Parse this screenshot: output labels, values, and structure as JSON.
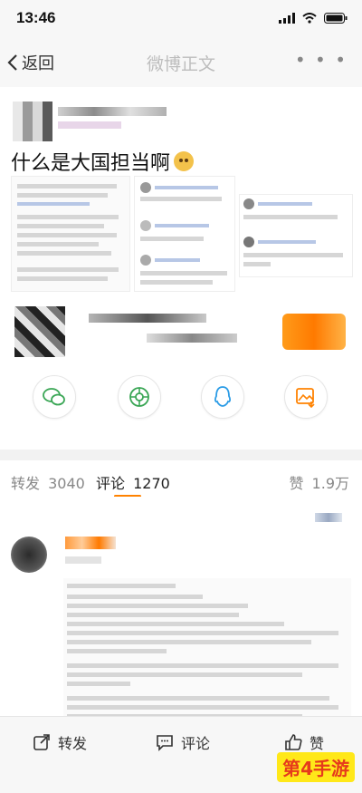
{
  "status_bar": {
    "time": "13:46"
  },
  "nav": {
    "back_label": "返回",
    "title": "微博正文",
    "more_label": "• • •"
  },
  "post": {
    "title": "什么是大国担当啊"
  },
  "tabs": {
    "repost_label": "转发",
    "repost_count": "3040",
    "comment_label": "评论",
    "comment_count": "1270",
    "like_label": "赞",
    "like_count": "1.9万"
  },
  "bottom_bar": {
    "repost": "转发",
    "comment": "评论",
    "like": "赞"
  },
  "watermark": "第4手游",
  "colors": {
    "accent": "#ff8200",
    "watermark": "#e63a1c"
  }
}
